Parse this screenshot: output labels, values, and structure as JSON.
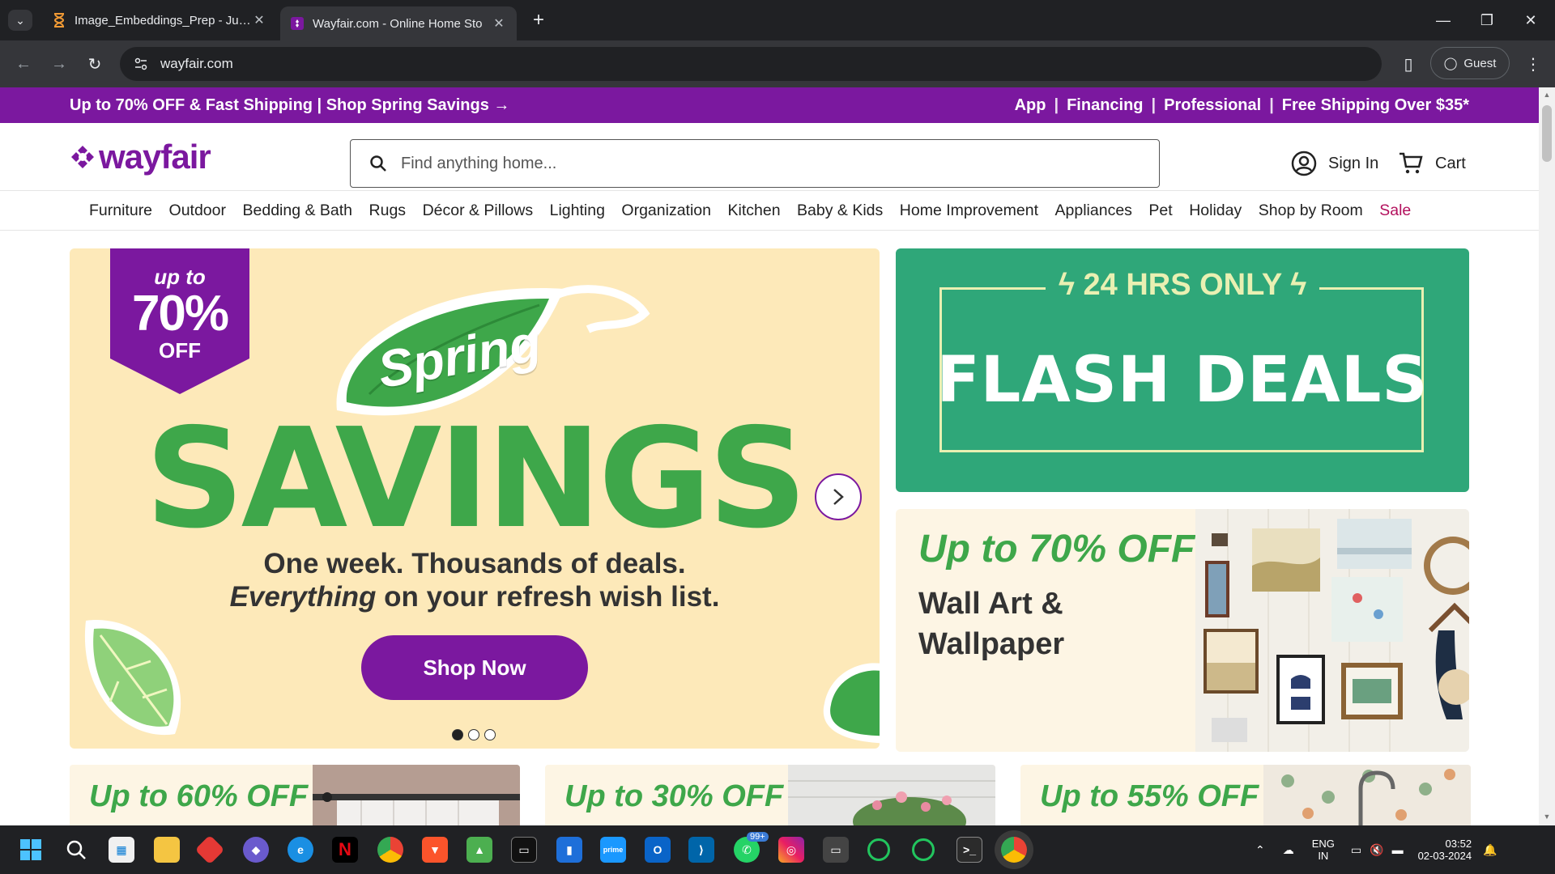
{
  "browser": {
    "tabs": [
      {
        "title": "Image_Embeddings_Prep - Jupy",
        "active": false
      },
      {
        "title": "Wayfair.com - Online Home Sto",
        "active": true
      }
    ],
    "url": "wayfair.com",
    "profile_label": "Guest"
  },
  "promo": {
    "left": "Up to 70% OFF & Fast Shipping | Shop Spring Savings →",
    "right": [
      "App",
      "Financing",
      "Professional",
      "Free Shipping Over $35*"
    ]
  },
  "header": {
    "logo": "wayfair",
    "search_placeholder": "Find anything home...",
    "signin": "Sign In",
    "cart": "Cart"
  },
  "categories": [
    "Furniture",
    "Outdoor",
    "Bedding & Bath",
    "Rugs",
    "Décor & Pillows",
    "Lighting",
    "Organization",
    "Kitchen",
    "Baby & Kids",
    "Home Improvement",
    "Appliances",
    "Pet",
    "Holiday",
    "Shop by Room",
    "Sale"
  ],
  "hero": {
    "badge_upto": "up to",
    "badge_pct": "70%",
    "badge_off": "OFF",
    "spring": "Spring",
    "savings": "SAVINGS",
    "line1": "One week. Thousands of deals.",
    "line2_em": "Everything",
    "line2_rest": " on your refresh wish list.",
    "cta": "Shop Now",
    "carousel_count": 3,
    "carousel_active": 1
  },
  "flash": {
    "top": "24 HRS ONLY",
    "title": "FLASH DEALS"
  },
  "wallart": {
    "off": "Up to 70% OFF",
    "title_line1": "Wall Art &",
    "title_line2": "Wallpaper"
  },
  "cards": [
    {
      "off": "Up to 60% OFF"
    },
    {
      "off": "Up to 30% OFF"
    },
    {
      "off": "Up to 55% OFF"
    }
  ],
  "taskbar": {
    "whatsapp_badge": "99+",
    "lang_line1": "ENG",
    "lang_line2": "IN",
    "time": "03:52",
    "date": "02-03-2024"
  },
  "colors": {
    "brand_purple": "#7b189f",
    "savings_green": "#3ea74a",
    "flash_green": "#2fa779",
    "hero_bg": "#fde9b9"
  }
}
